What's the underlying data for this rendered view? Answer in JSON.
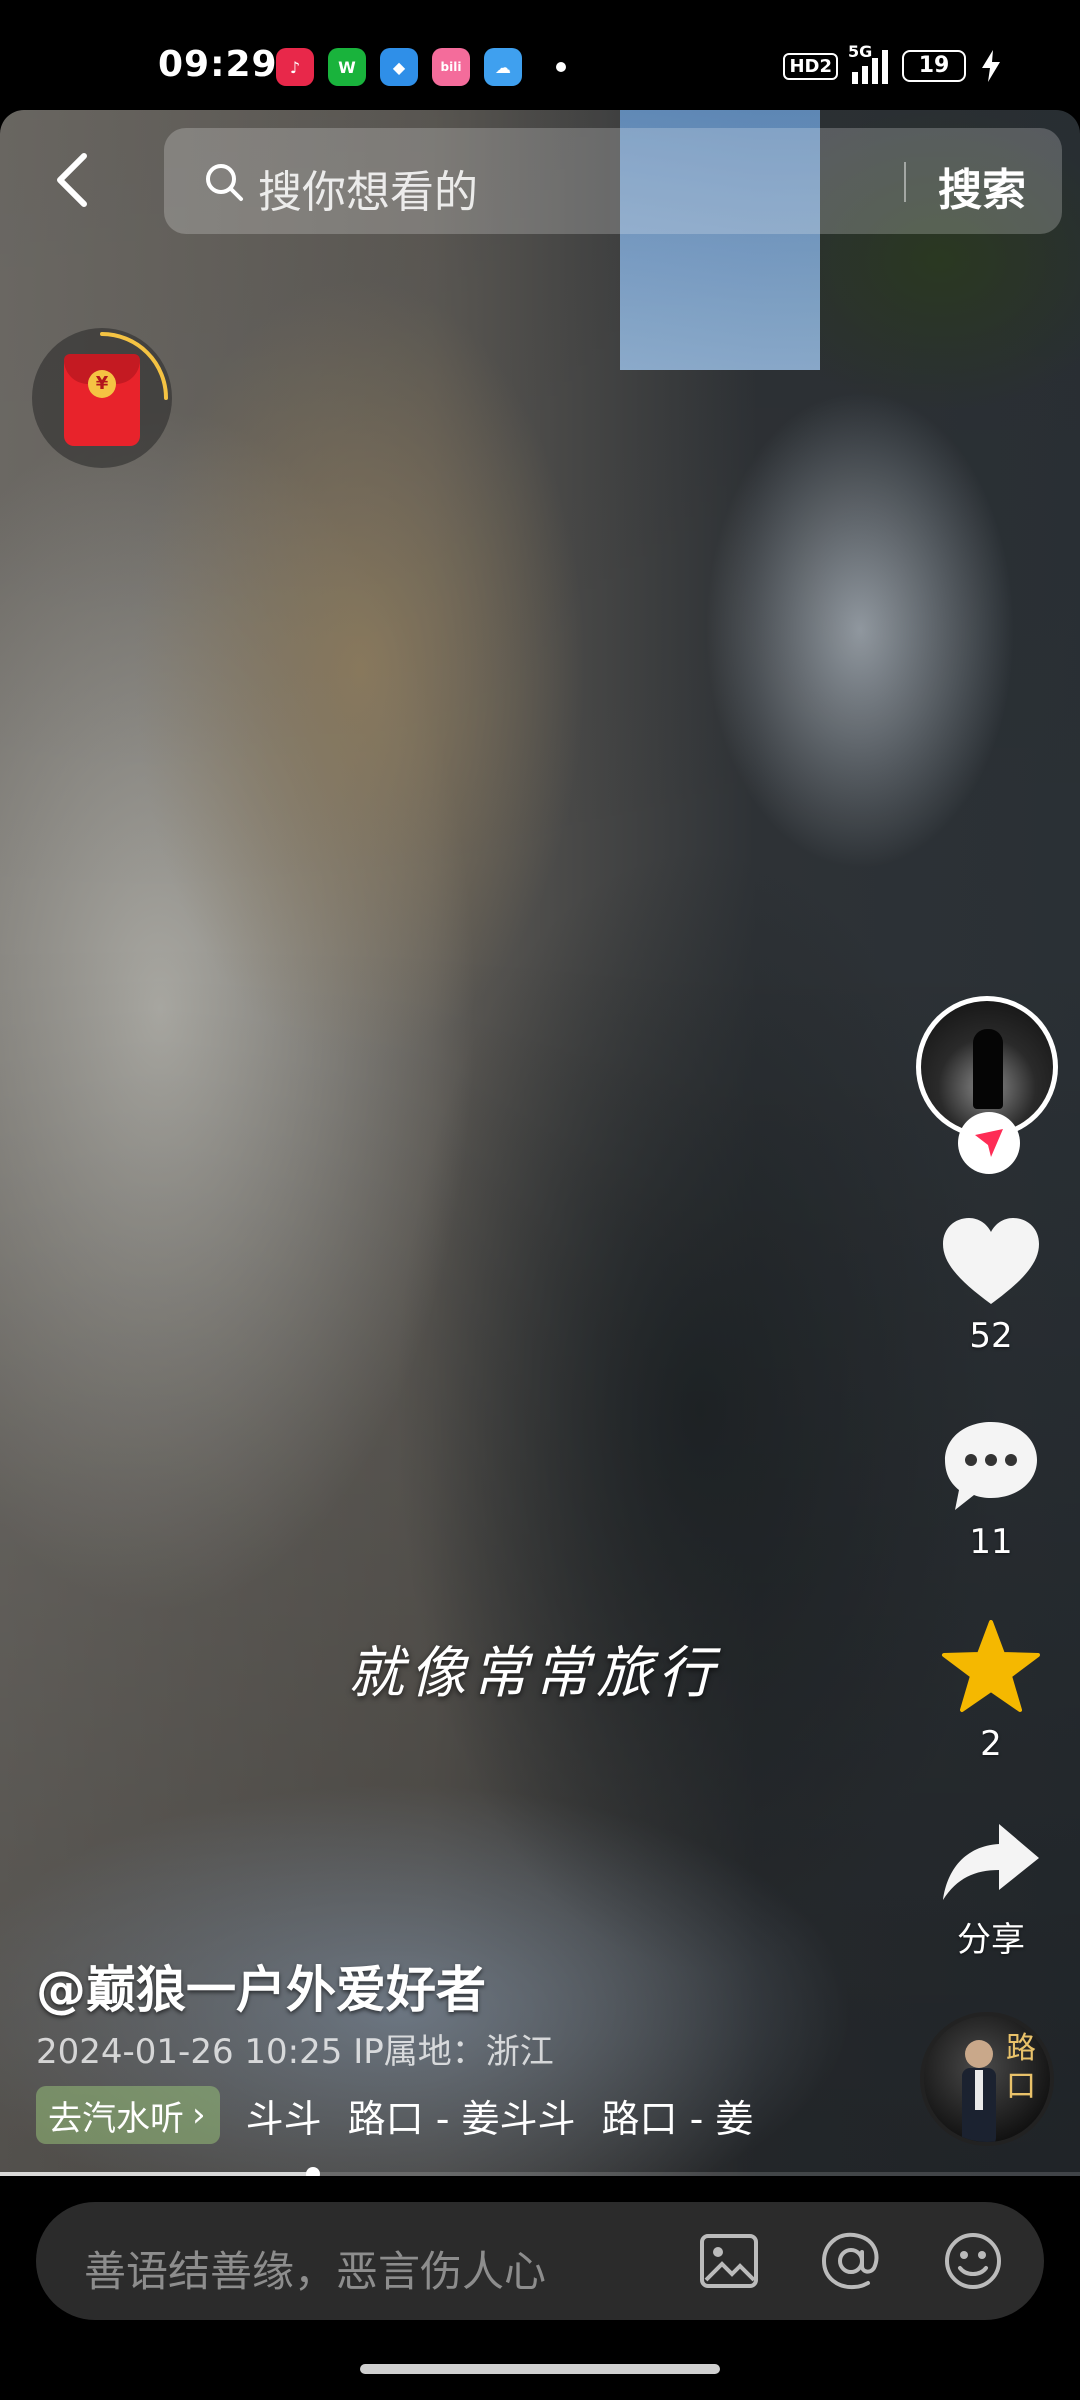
{
  "status_bar": {
    "time": "09:29",
    "hd_label": "HD2",
    "network": "5G",
    "battery": "19",
    "apps": [
      {
        "name": "music-app-icon",
        "color": "#e8284a",
        "glyph": "♪"
      },
      {
        "name": "wechat-app-icon",
        "color": "#19b33c",
        "glyph": "W"
      },
      {
        "name": "browser-app-icon",
        "color": "#2f8fe8",
        "glyph": "◆"
      },
      {
        "name": "bilibili-app-icon",
        "color": "#f46c9b",
        "glyph": "bili"
      },
      {
        "name": "cloud-app-icon",
        "color": "#3fa0ef",
        "glyph": "☁"
      }
    ]
  },
  "search": {
    "placeholder": "搜你想看的",
    "button_label": "搜索"
  },
  "video": {
    "subtitle": "就像常常旅行",
    "author": "@巅狼一户外爱好者",
    "meta": "2024-01-26 10:25  IP属地：浙江",
    "progress": 0.29
  },
  "actions": {
    "likes": "52",
    "comments": "11",
    "favorites": "2",
    "share_label": "分享"
  },
  "music": {
    "chip_label": "去汽水听",
    "items": [
      "斗斗",
      "路口 - 姜斗斗",
      "路口 - 姜"
    ],
    "cover_text": "路口"
  },
  "comment": {
    "placeholder": "善语结善缘，恶言伤人心"
  },
  "colors": {
    "favorite_star": "#f5b800",
    "follow_badge": "#fe2c55"
  }
}
